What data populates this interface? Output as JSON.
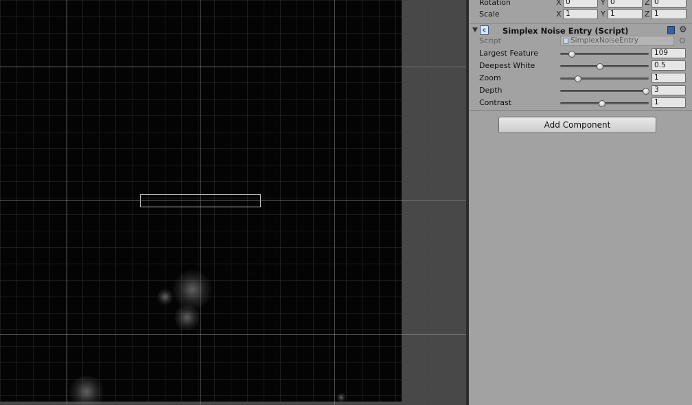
{
  "transform": {
    "rotation": {
      "label": "Rotation",
      "x_axis": "X",
      "y_axis": "Y",
      "z_axis": "Z",
      "x": "0",
      "y": "0",
      "z": "0"
    },
    "scale": {
      "label": "Scale",
      "x_axis": "X",
      "y_axis": "Y",
      "z_axis": "Z",
      "x": "1",
      "y": "1",
      "z": "1"
    }
  },
  "component": {
    "title": "Simplex Noise Entry (Script)",
    "script_label": "Script",
    "script_value": "SimplexNoiseEntry",
    "icons": [
      "script-icon",
      "help-book-icon",
      "gear-icon",
      "foldout-arrow-icon",
      "object-picker-icon"
    ],
    "fields": [
      {
        "label": "Largest Feature",
        "value": "109",
        "slider_fraction": 0.13
      },
      {
        "label": "Deepest White",
        "value": "0.5",
        "slider_fraction": 0.45
      },
      {
        "label": "Zoom",
        "value": "1",
        "slider_fraction": 0.2
      },
      {
        "label": "Depth",
        "value": "3",
        "slider_fraction": 0.97
      },
      {
        "label": "Contrast",
        "value": "1",
        "slider_fraction": 0.47
      }
    ]
  },
  "add_component_label": "Add Component",
  "colors": {
    "inspector_bg": "#a2a2a2",
    "scene_bg": "#040404",
    "selection_outline": "#bdbdbd"
  }
}
